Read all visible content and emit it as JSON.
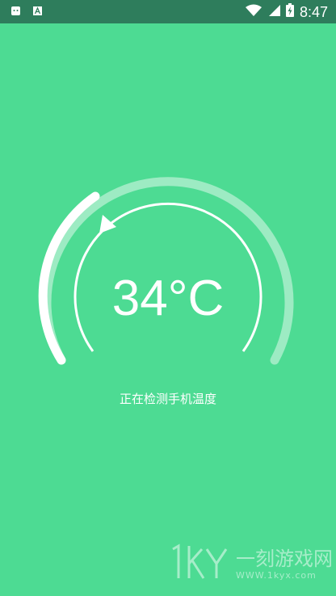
{
  "status_bar": {
    "time": "8:47",
    "icons_left": [
      "android-notification-icon",
      "app-a-icon"
    ],
    "icons_right": [
      "wifi-icon",
      "signal-icon",
      "battery-charging-icon"
    ]
  },
  "gauge": {
    "progress": 0.22,
    "color_track": "rgba(255,255,255,0.45)",
    "color_progress": "#ffffff"
  },
  "temperature": {
    "value": "34°C"
  },
  "status_message": "正在检测手机温度",
  "watermark": {
    "title": "一刻游戏网",
    "url": "WWW.1kyx.com"
  },
  "theme": {
    "background": "#4ddb93",
    "status_bar": "#2e7d5c"
  }
}
